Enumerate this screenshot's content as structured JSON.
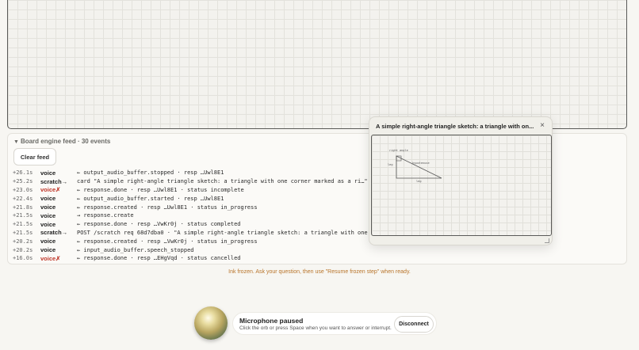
{
  "feed": {
    "title": "Board engine feed · 30 events",
    "toggle_icon": "triangle-down-icon",
    "clear_label": "Clear feed",
    "rows": [
      {
        "time": "+26.1s",
        "kind": "voice",
        "error": false,
        "msg": "← output_audio_buffer.stopped · resp …Uwl8E1"
      },
      {
        "time": "+25.2s",
        "kind": "scratch→",
        "error": false,
        "msg": "card \"A simple right-angle triangle sketch: a triangle with one corner marked as a ri…\" ·"
      },
      {
        "time": "+23.0s",
        "kind": "voice✗",
        "error": true,
        "msg": "← response.done · resp …Uwl8E1 · status incomplete"
      },
      {
        "time": "+22.4s",
        "kind": "voice",
        "error": false,
        "msg": "← output_audio_buffer.started · resp …Uwl8E1"
      },
      {
        "time": "+21.8s",
        "kind": "voice",
        "error": false,
        "msg": "← response.created · resp …Uwl8E1 · status in_progress"
      },
      {
        "time": "+21.5s",
        "kind": "voice",
        "error": false,
        "msg": "→ response.create"
      },
      {
        "time": "+21.5s",
        "kind": "voice",
        "error": false,
        "msg": "← response.done · resp …VwKr0j · status completed"
      },
      {
        "time": "+21.5s",
        "kind": "scratch→",
        "error": false,
        "msg": "POST /scratch req 68d7dba0 · \"A simple right-angle triangle sketch: a triangle with one c"
      },
      {
        "time": "+20.2s",
        "kind": "voice",
        "error": false,
        "msg": "← response.created · resp …VwKr0j · status in_progress"
      },
      {
        "time": "+20.2s",
        "kind": "voice",
        "error": false,
        "msg": "← input_audio_buffer.speech_stopped"
      },
      {
        "time": "+16.0s",
        "kind": "voice✗",
        "error": true,
        "msg": "← response.done · resp …EHgVqd · status cancelled"
      }
    ]
  },
  "popup": {
    "title": "A simple right-angle triangle sketch: a triangle with on...",
    "close_glyph": "×",
    "sketch_labels": {
      "right_angle": "right angle",
      "hypotenuse": "hypotenuse",
      "leg_side": "leg",
      "leg_bottom": "leg"
    }
  },
  "status_text": "Ink frozen. Ask your question, then use \"Resume frozen step\" when ready.",
  "mic": {
    "title": "Microphone paused",
    "subtitle": "Click the orb or press Space when you want to answer or interrupt.",
    "disconnect_label": "Disconnect"
  },
  "colors": {
    "error": "#c0392b",
    "status_text": "#b8742a",
    "board_border": "#5a5a58"
  }
}
